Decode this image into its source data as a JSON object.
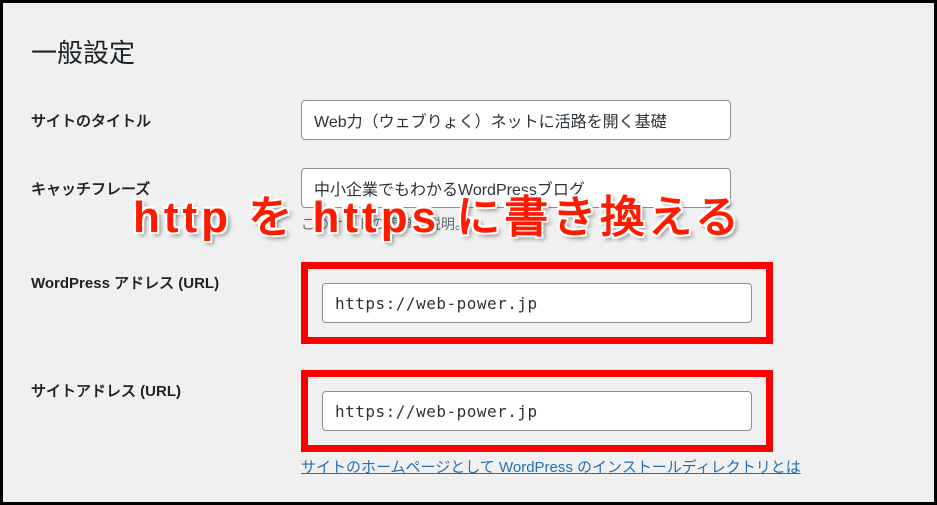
{
  "page": {
    "title": "一般設定"
  },
  "fields": {
    "site_title": {
      "label": "サイトのタイトル",
      "value": "Web力（ウェブりょく）ネットに活路を開く基礎"
    },
    "tagline": {
      "label": "キャッチフレーズ",
      "value": "中小企業でもわかるWordPressブログ",
      "description": "このサイトの簡単な説明。"
    },
    "wp_url": {
      "label": "WordPress アドレス (URL)",
      "value": "https://web-power.jp"
    },
    "site_url": {
      "label": "サイトアドレス (URL)",
      "value": "https://web-power.jp",
      "help_link": "サイトのホームページとして WordPress のインストールディレクトリとは"
    }
  },
  "annotation": {
    "text": "http を https に書き換える",
    "color": "#ff1a00"
  }
}
